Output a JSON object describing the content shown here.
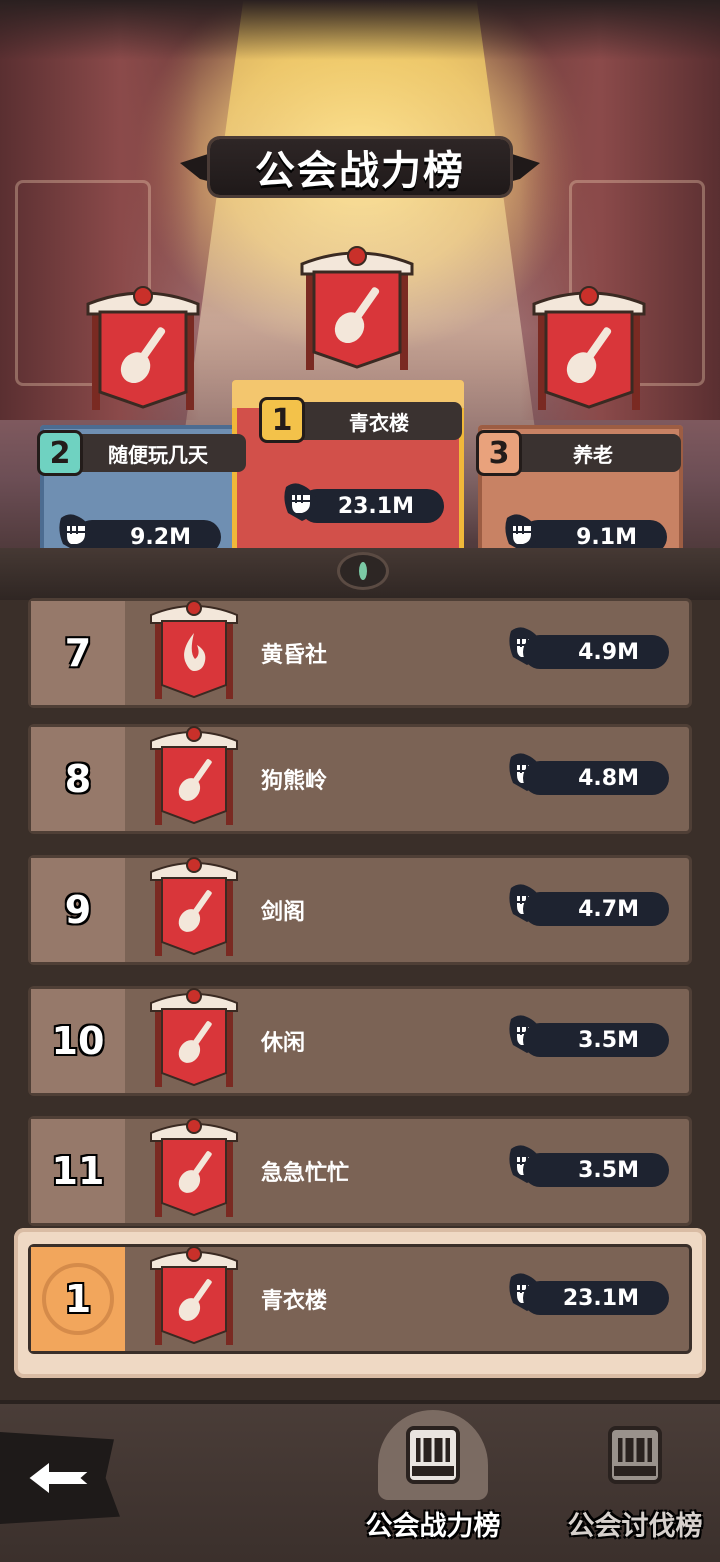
{
  "title": "公会战力榜",
  "podium": [
    {
      "rank": "1",
      "name": "青衣楼",
      "power": "23.1M"
    },
    {
      "rank": "2",
      "name": "随便玩几天",
      "power": "9.2M"
    },
    {
      "rank": "3",
      "name": "养老",
      "power": "9.1M"
    }
  ],
  "list": [
    {
      "rank": "7",
      "name": "黄昏社",
      "power": "4.9M",
      "emblem": "flame-icon"
    },
    {
      "rank": "8",
      "name": "狗熊岭",
      "power": "4.8M",
      "emblem": "brush-icon"
    },
    {
      "rank": "9",
      "name": "剑阁",
      "power": "4.7M",
      "emblem": "brush-icon"
    },
    {
      "rank": "10",
      "name": "休闲",
      "power": "3.5M",
      "emblem": "brush-icon"
    },
    {
      "rank": "11",
      "name": "急急忙忙",
      "power": "3.5M",
      "emblem": "brush-icon"
    }
  ],
  "self": {
    "rank": "1",
    "name": "青衣楼",
    "power": "23.1M"
  },
  "tabs": [
    {
      "label": "公会战力榜",
      "active": true
    },
    {
      "label": "公会讨伐榜",
      "active": false
    }
  ],
  "colors": {
    "gold": "#f0b83a",
    "silver_blue": "#6f8fb2",
    "bronze": "#c88264",
    "row_bg": "#7b6355",
    "pill": "#1e2330"
  }
}
